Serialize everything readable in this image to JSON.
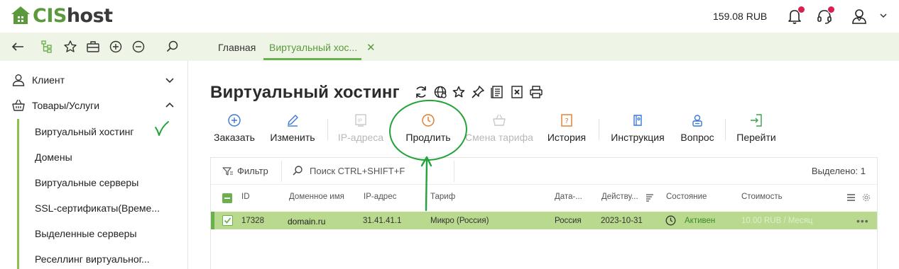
{
  "header": {
    "logo_cis": "CIS",
    "logo_host": "host",
    "balance": "159.08 RUB",
    "notifications_badge": true,
    "support_badge": true
  },
  "tabs": [
    {
      "label": "Главная",
      "active": false
    },
    {
      "label": "Виртуальный хос...",
      "active": true
    }
  ],
  "sidebar": {
    "groups": [
      {
        "label": "Клиент",
        "expanded": false
      },
      {
        "label": "Товары/Услуги",
        "expanded": true
      }
    ],
    "items": [
      {
        "label": "Виртуальный хостинг",
        "active": true
      },
      {
        "label": "Домены"
      },
      {
        "label": "Виртуальные серверы"
      },
      {
        "label": "SSL-сертификаты(Време..."
      },
      {
        "label": "Выделенные серверы"
      },
      {
        "label": "Реселлинг виртуальног..."
      }
    ]
  },
  "main": {
    "title": "Виртуальный хостинг",
    "actions": [
      {
        "label": "Заказать",
        "icon": "plus-circle-icon",
        "enabled": true
      },
      {
        "label": "Изменить",
        "icon": "pencil-icon",
        "enabled": true
      },
      {
        "label": "IP-адреса",
        "icon": "ip-icon",
        "enabled": false
      },
      {
        "label": "Продлить",
        "icon": "clock-icon",
        "enabled": true
      },
      {
        "label": "Смена тарифа",
        "icon": "basket-icon",
        "enabled": false
      },
      {
        "label": "История",
        "icon": "history-icon",
        "enabled": true
      },
      {
        "label": "Инструкция",
        "icon": "instruction-icon",
        "enabled": true
      },
      {
        "label": "Вопрос",
        "icon": "question-user-icon",
        "enabled": true
      },
      {
        "label": "Перейти",
        "icon": "goto-icon",
        "enabled": true
      }
    ]
  },
  "table": {
    "filter_label": "Фильтр",
    "search_placeholder": "Поиск CTRL+SHIFT+F",
    "selected_label": "Выделено: 1",
    "columns": [
      "ID",
      "Доменное имя",
      "IP-адрес",
      "Тариф",
      "Дата-...",
      "Действу...",
      "Состояние",
      "Стоимость"
    ],
    "rows": [
      {
        "id": "17328",
        "domain": "domain.ru",
        "ip": "31.41.41.1",
        "tariff": "Микро (Россия)",
        "datacenter": "Россия",
        "valid_until": "2023-10-31",
        "status": "Активен",
        "cost": "10.00 RUB / Месяц",
        "selected": true
      }
    ]
  },
  "colors": {
    "brand_green": "#6ab04c",
    "strip_bg": "#eef5e6",
    "row_selected": "#b9d98f",
    "annotation": "#22a33a",
    "badge": "#d91f4d"
  }
}
